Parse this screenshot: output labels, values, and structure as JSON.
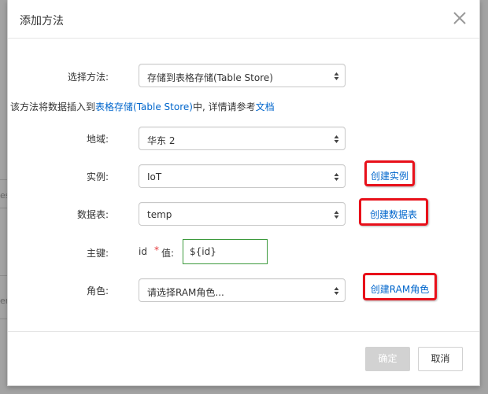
{
  "background": {
    "fragments": [
      "es",
      "er"
    ]
  },
  "dialog": {
    "title": "添加方法",
    "close_icon": "close-icon"
  },
  "form": {
    "method": {
      "label": "选择方法:",
      "value": "存储到表格存储(Table Store)"
    },
    "info": {
      "prefix": "该方法将数据插入到",
      "link": "表格存储(Table Store)",
      "middle": "中, 详情请参考",
      "doc_link": "文档"
    },
    "region": {
      "label": "地域:",
      "value": "华东 2"
    },
    "instance": {
      "label": "实例:",
      "value": "IoT",
      "action": "创建实例"
    },
    "table": {
      "label": "数据表:",
      "value": "temp",
      "action": "创建数据表"
    },
    "primary_key": {
      "label": "主键:",
      "name": "id",
      "required_mark": "*",
      "value_label": "值:",
      "value": "${id}"
    },
    "role": {
      "label": "角色:",
      "value": "请选择RAM角色...",
      "action": "创建RAM角色"
    }
  },
  "footer": {
    "confirm_label": "确定",
    "cancel_label": "取消"
  },
  "colors": {
    "link": "#0066cc",
    "highlight_border": "#e8101a",
    "required": "#e4393c",
    "input_focus_border": "#3c9a3c",
    "confirm_disabled": "#d2d2d2"
  }
}
